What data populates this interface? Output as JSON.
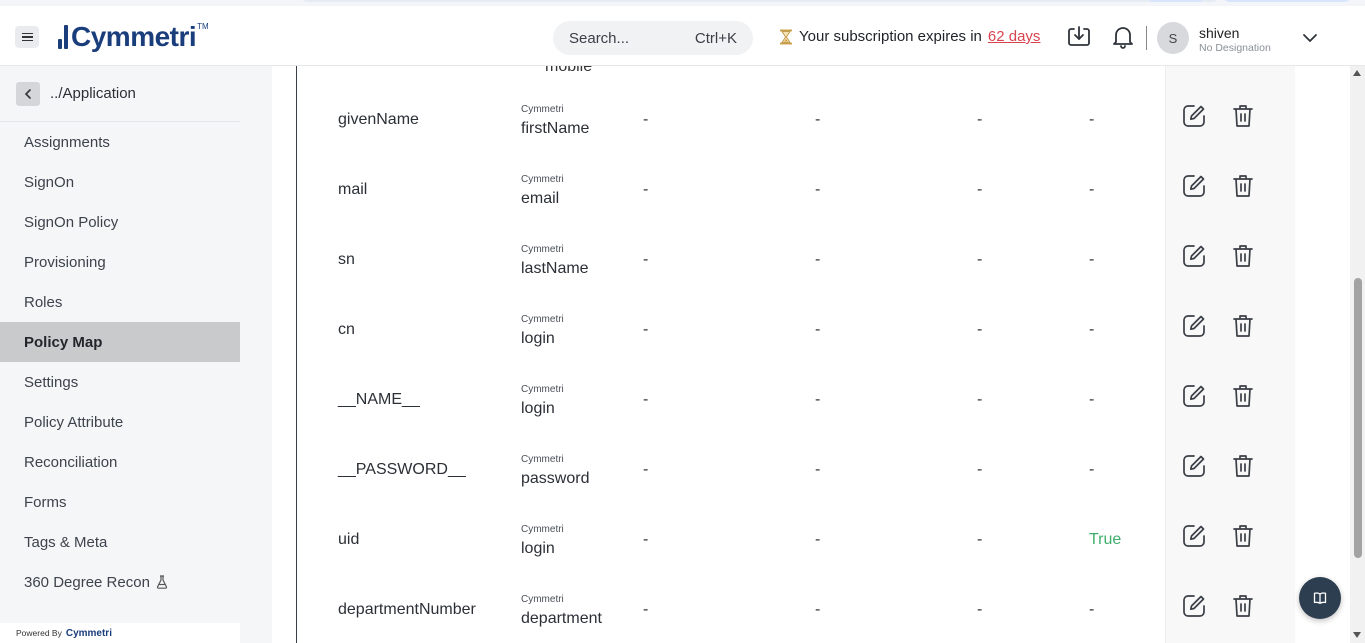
{
  "header": {
    "brand": "Cymmetri",
    "search_placeholder": "Search...",
    "search_shortcut": "Ctrl+K",
    "subscription_prefix": "Your subscription expires in",
    "subscription_days": "62 days",
    "user_initial": "S",
    "user_name": "shiven",
    "user_designation": "No Designation"
  },
  "sidebar": {
    "back_label": "../Application",
    "items": [
      {
        "label": "Assignments"
      },
      {
        "label": "SignOn"
      },
      {
        "label": "SignOn Policy"
      },
      {
        "label": "Provisioning"
      },
      {
        "label": "Roles"
      },
      {
        "label": "Policy Map",
        "active": true
      },
      {
        "label": "Settings"
      },
      {
        "label": "Policy Attribute"
      },
      {
        "label": "Reconciliation"
      },
      {
        "label": "Forms"
      },
      {
        "label": "Tags & Meta"
      },
      {
        "label": "360 Degree Recon"
      }
    ],
    "powered_by": "Powered By",
    "powered_brand": "Cymmetri"
  },
  "table": {
    "cut_off_attr": "mobile",
    "rows": [
      {
        "name": "givenName",
        "source": "Cymmetri",
        "attr": "firstName",
        "d1": "-",
        "d2": "-",
        "d3": "-",
        "d4": "-"
      },
      {
        "name": "mail",
        "source": "Cymmetri",
        "attr": "email",
        "d1": "-",
        "d2": "-",
        "d3": "-",
        "d4": "-"
      },
      {
        "name": "sn",
        "source": "Cymmetri",
        "attr": "lastName",
        "d1": "-",
        "d2": "-",
        "d3": "-",
        "d4": "-"
      },
      {
        "name": "cn",
        "source": "Cymmetri",
        "attr": "login",
        "d1": "-",
        "d2": "-",
        "d3": "-",
        "d4": "-"
      },
      {
        "name": "__NAME__",
        "source": "Cymmetri",
        "attr": "login",
        "d1": "-",
        "d2": "-",
        "d3": "-",
        "d4": "-"
      },
      {
        "name": "__PASSWORD__",
        "source": "Cymmetri",
        "attr": "password",
        "d1": "-",
        "d2": "-",
        "d3": "-",
        "d4": "-"
      },
      {
        "name": "uid",
        "source": "Cymmetri",
        "attr": "login",
        "d1": "-",
        "d2": "-",
        "d3": "-",
        "d4": "True"
      },
      {
        "name": "departmentNumber",
        "source": "Cymmetri",
        "attr": "department",
        "d1": "-",
        "d2": "-",
        "d3": "-",
        "d4": "-"
      }
    ]
  },
  "colors": {
    "brand": "#1a3d7c",
    "days_link": "#d9434f",
    "true_value": "#3fae6b",
    "active_nav": "#c9cacc"
  }
}
